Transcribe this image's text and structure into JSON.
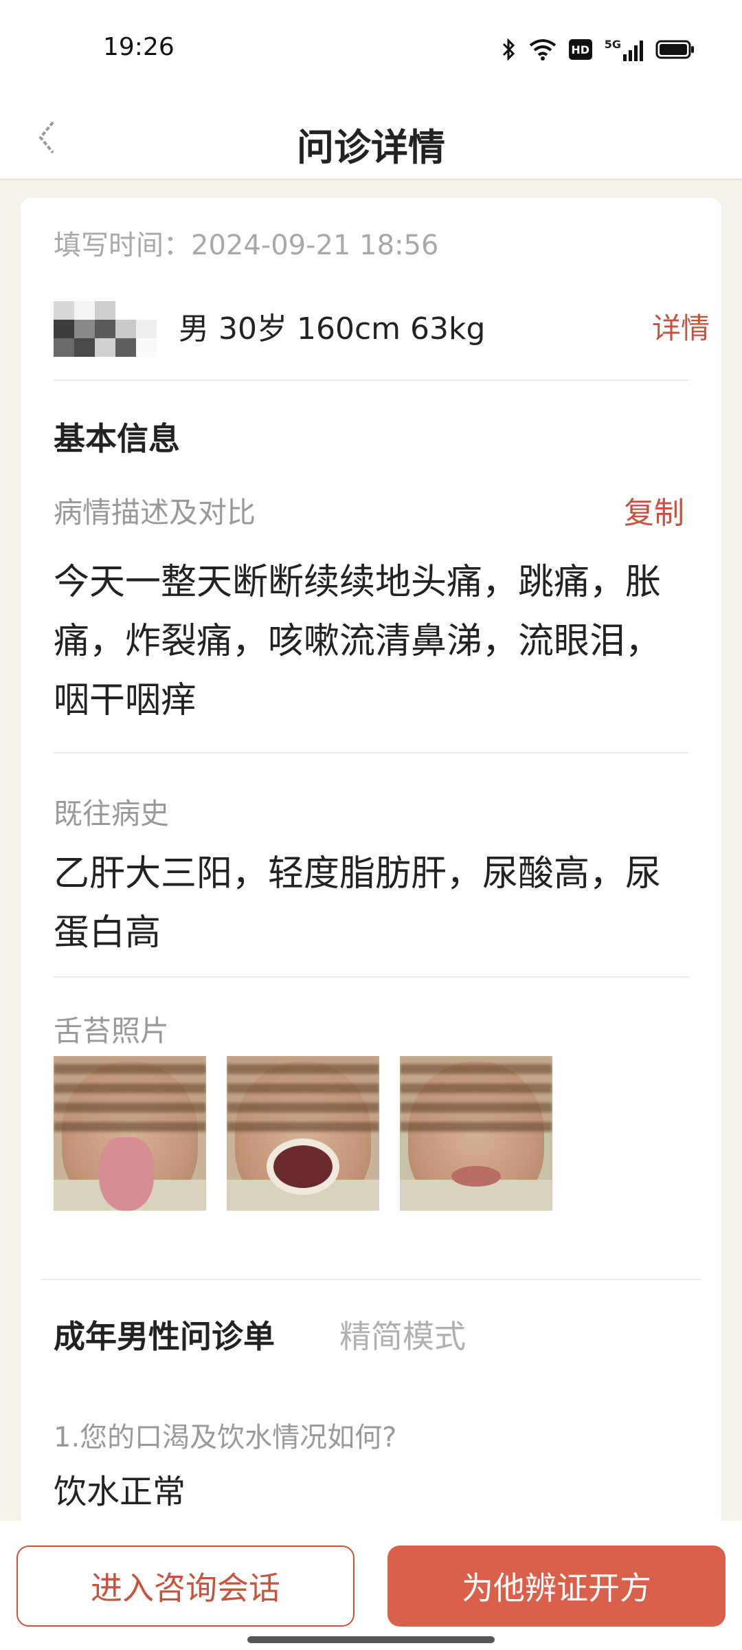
{
  "status_bar": {
    "time": "19:26",
    "icons": [
      "bluetooth-icon",
      "wifi-icon",
      "hd-icon",
      "signal-5g-icon",
      "battery-icon"
    ],
    "hd_label": "HD",
    "network_label": "5G"
  },
  "nav": {
    "title": "问诊详情",
    "back_icon": "back-arrow-icon"
  },
  "record": {
    "fill_time": "填写时间：2024-09-21 18:56",
    "patient": "男 30岁 160cm 63kg",
    "detail_link": "详情"
  },
  "basic_info": {
    "title": "基本信息",
    "description_label": "病情描述及对比",
    "copy_label": "复制",
    "description_lines": [
      "今天一整天断断续续地头痛，跳痛，胀",
      "痛，炸裂痛，咳嗽流清鼻涕，流眼泪，",
      "咽干咽痒"
    ],
    "history_label": "既往病史",
    "history_lines": [
      "乙肝大三阳，轻度脂肪肝，尿酸高，尿",
      "蛋白高"
    ],
    "tongue_label": "舌苔照片"
  },
  "questionnaire": {
    "title": "成年男性问诊单",
    "mode": "精简模式",
    "question": "1.您的口渴及饮水情况如何?",
    "answer": "饮水正常"
  },
  "actions": {
    "consult_label": "进入咨询会话",
    "prescribe_label": "为他辨证开方"
  },
  "colors": {
    "accent": "#c4543f",
    "primary_button": "#d9614c",
    "background": "#f5f2ec"
  }
}
